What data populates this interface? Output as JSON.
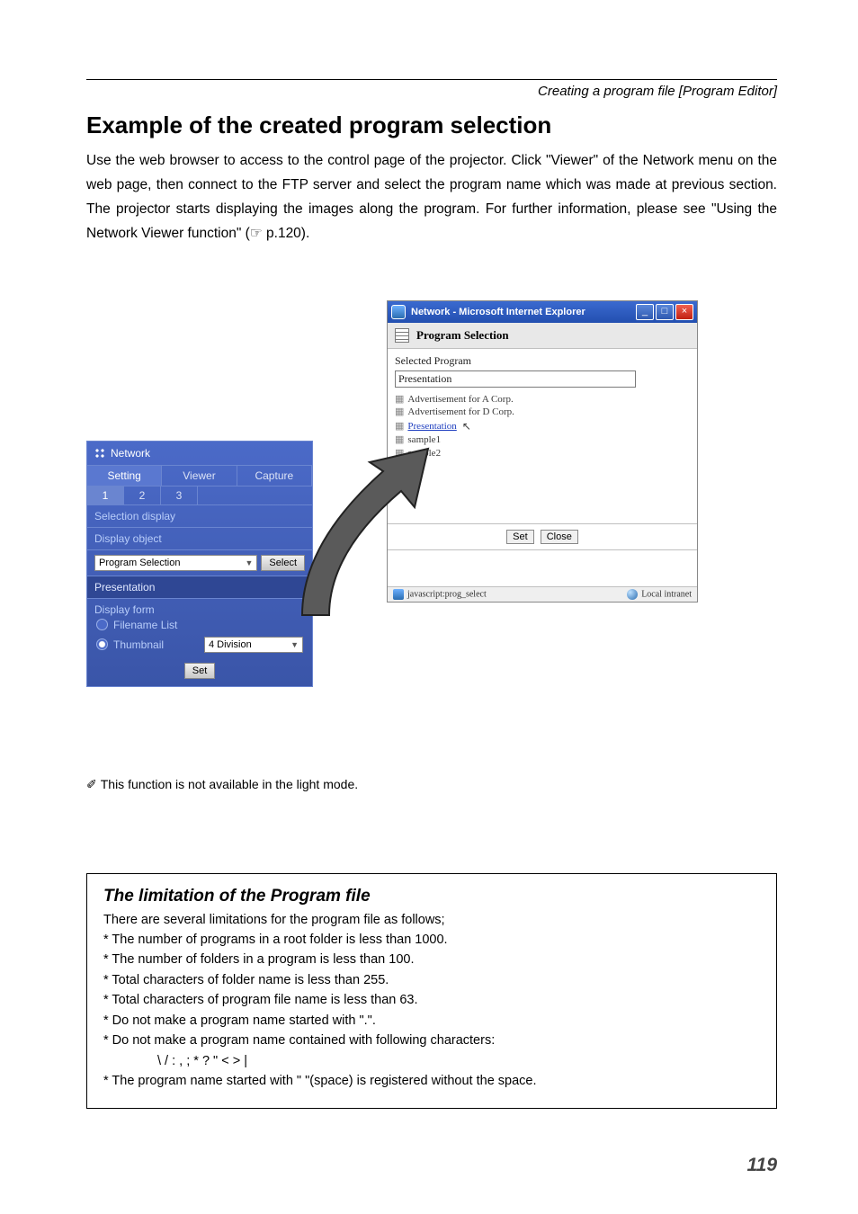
{
  "breadcrumb": "Creating a program file [Program Editor]",
  "heading": "Example of the created program selection",
  "body": "Use the web browser to access to the control page of the projector. Click \"Viewer\" of the Network menu on the web page, then connect to the FTP server and select the program name which was made at previous section. The projector starts displaying the images along the program. For further information, please see \"Using the Network Viewer function\" (☞ p.120).",
  "right_window": {
    "title": "Network - Microsoft Internet Explorer",
    "section_header": "Program Selection",
    "selected_label": "Selected Program",
    "selected_value": "Presentation",
    "programs": {
      "p0": "Advertisement for A Corp.",
      "p1": "Advertisement for D Corp.",
      "p2": "Presentation",
      "p3": "sample1",
      "p4": "sample2"
    },
    "btn_set": "Set",
    "btn_close": "Close",
    "status_left": "javascript:prog_select",
    "status_right": "Local intranet"
  },
  "left_window": {
    "title": "Network",
    "tabs": {
      "t0": "Setting",
      "t1": "Viewer",
      "t2": "Capture"
    },
    "nums": {
      "n0": "1",
      "n1": "2",
      "n2": "3"
    },
    "row_selection": "Selection display",
    "row_display_object": "Display object",
    "program_selection_label": "Program Selection",
    "select_btn": "Select",
    "presentation": "Presentation",
    "display_form": "Display form",
    "filename_list": "Filename List",
    "thumbnail": "Thumbnail",
    "division": "4 Division",
    "set_btn": "Set"
  },
  "note": "This function is not available in the light mode.",
  "box": {
    "title": "The limitation of the Program file",
    "intro": "There are several limitations for the program file as follows;",
    "l1": "* The number of programs in a root folder is less than 1000.",
    "l2": "* The number of folders in a program is less than 100.",
    "l3": "* Total characters of folder name is less than 255.",
    "l4": "* Total characters of program file name is less than 63.",
    "l5": "* Do not make a program name started with \".\".",
    "l6": "* Do not make a program name contained with following characters:",
    "chars": "\\ / : , ; * ? \" < > |",
    "l7": "* The program name started with \" \"(space) is registered without the space."
  },
  "page_number": "119"
}
